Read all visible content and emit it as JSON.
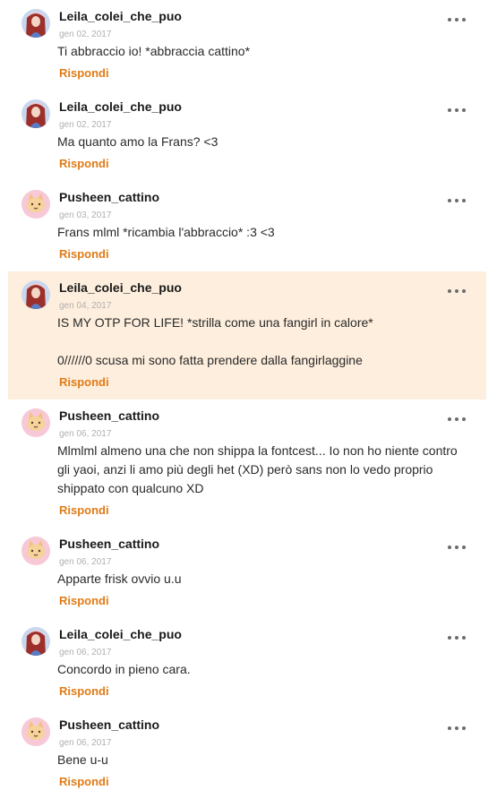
{
  "comments": [
    {
      "user": "Leila_colei_che_puo",
      "date": "gen 02, 2017",
      "text": "Ti abbraccio io! *abbraccia cattino*",
      "reply": "Rispondi",
      "avatar": "leila-avatar"
    },
    {
      "user": "Leila_colei_che_puo",
      "date": "gen 02, 2017",
      "text": "Ma quanto amo la Frans? <3",
      "reply": "Rispondi",
      "avatar": "leila-avatar"
    },
    {
      "user": "Pusheen_cattino",
      "date": "gen 03, 2017",
      "text": "Frans mlml *ricambia l'abbraccio* :3 <3",
      "reply": "Rispondi",
      "avatar": "pusheen-avatar"
    },
    {
      "user": "Leila_colei_che_puo",
      "date": "gen 04, 2017",
      "text": "IS MY OTP FOR LIFE! *strilla come una fangirl in calore*\n\n0//////0 scusa mi sono fatta prendere dalla fangirlaggine",
      "reply": "Rispondi",
      "avatar": "leila-avatar"
    },
    {
      "user": "Pusheen_cattino",
      "date": "gen 06, 2017",
      "text": "Mlmlml almeno una che non shippa la fontcest... Io non ho niente contro gli yaoi, anzi li amo più degli het (XD) però sans non lo vedo proprio shippato con qualcuno XD",
      "reply": "Rispondi",
      "avatar": "pusheen-avatar"
    },
    {
      "user": "Pusheen_cattino",
      "date": "gen 06, 2017",
      "text": "Apparte frisk ovvio u.u",
      "reply": "Rispondi",
      "avatar": "pusheen-avatar"
    },
    {
      "user": "Leila_colei_che_puo",
      "date": "gen 06, 2017",
      "text": "Concordo in pieno cara.",
      "reply": "Rispondi",
      "avatar": "leila-avatar"
    },
    {
      "user": "Pusheen_cattino",
      "date": "gen 06, 2017",
      "text": "Bene u-u",
      "reply": "Rispondi",
      "avatar": "pusheen-avatar"
    }
  ],
  "colors": {
    "reply": "#e07b16",
    "highlight": "#fdeedd",
    "date": "#b0b0b0"
  },
  "icons": {
    "more": "more-options-icon"
  }
}
